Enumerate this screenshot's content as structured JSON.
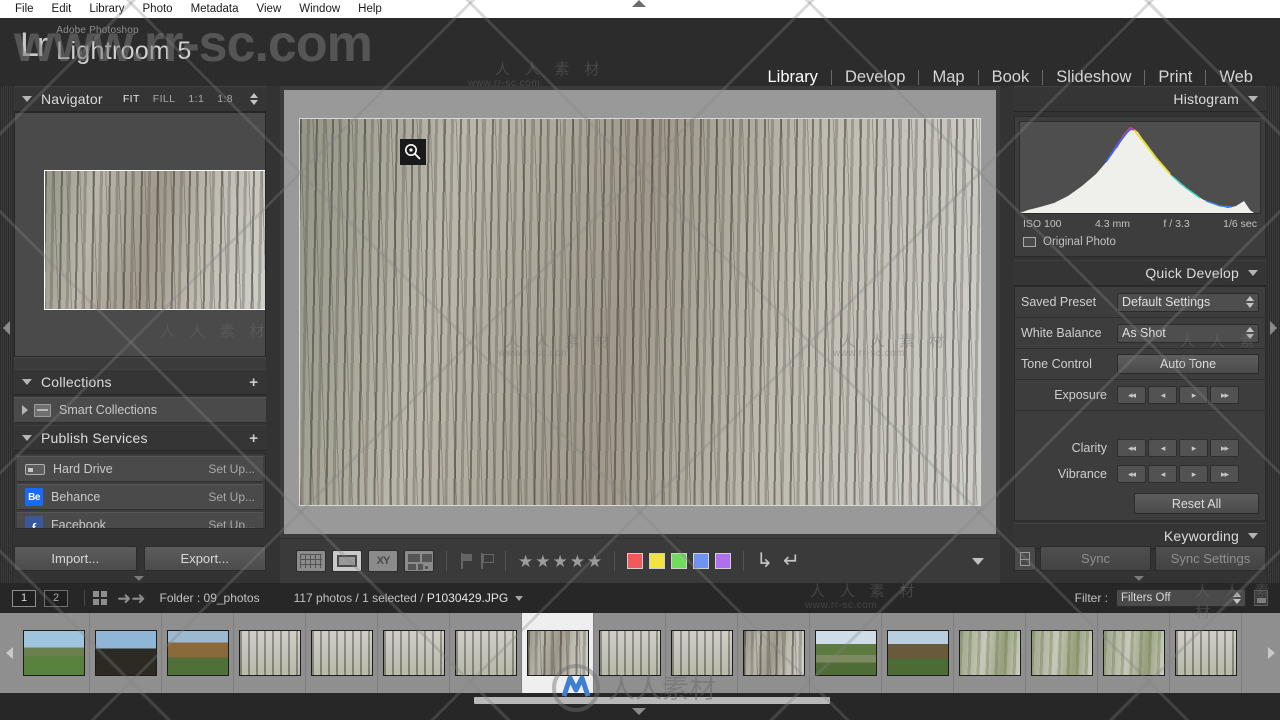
{
  "menubar": {
    "items": [
      "File",
      "Edit",
      "Library",
      "Photo",
      "Metadata",
      "View",
      "Window",
      "Help"
    ]
  },
  "header": {
    "logo_mark": "Lr",
    "product_prefix": "Adobe Photoshop",
    "product_name": "Lightroom 5",
    "modules": [
      {
        "label": "Library",
        "active": true
      },
      {
        "label": "Develop",
        "active": false
      },
      {
        "label": "Map",
        "active": false
      },
      {
        "label": "Book",
        "active": false
      },
      {
        "label": "Slideshow",
        "active": false
      },
      {
        "label": "Print",
        "active": false
      },
      {
        "label": "Web",
        "active": false
      }
    ]
  },
  "left_panel": {
    "navigator": {
      "title": "Navigator",
      "zoom_levels": [
        {
          "label": "FIT",
          "selected": true
        },
        {
          "label": "FILL",
          "selected": false
        },
        {
          "label": "1:1",
          "selected": false
        },
        {
          "label": "1:8",
          "selected": false
        }
      ]
    },
    "collections": {
      "title": "Collections",
      "add_label": "+",
      "items": [
        {
          "label": "Smart Collections",
          "icon": "collection-box-icon"
        }
      ]
    },
    "publish_services": {
      "title": "Publish Services",
      "add_label": "+",
      "items": [
        {
          "label": "Hard Drive",
          "action": "Set Up...",
          "icon": "hard-drive-icon"
        },
        {
          "label": "Behance",
          "action": "Set Up...",
          "icon": "behance-icon",
          "glyph": "Be"
        },
        {
          "label": "Facebook",
          "action": "Set Up...",
          "icon": "facebook-icon",
          "glyph": "f"
        }
      ]
    },
    "buttons": {
      "import": "Import...",
      "export": "Export..."
    }
  },
  "right_panel": {
    "histogram": {
      "title": "Histogram",
      "iso": "ISO 100",
      "focal_length": "4.3 mm",
      "aperture": "f / 3.3",
      "shutter": "1/6 sec",
      "original_photo": "Original Photo"
    },
    "quick_develop": {
      "title": "Quick Develop",
      "saved_preset_label": "Saved Preset",
      "saved_preset_value": "Default Settings",
      "white_balance_label": "White Balance",
      "white_balance_value": "As Shot",
      "tone_control_label": "Tone Control",
      "auto_tone_label": "Auto Tone",
      "sliders": [
        {
          "label": "Exposure"
        },
        {
          "label": "Clarity"
        },
        {
          "label": "Vibrance"
        }
      ],
      "arrow_glyphs": [
        "◂◂",
        "◂",
        "▸",
        "▸▸"
      ],
      "reset_label": "Reset All"
    },
    "keywording": {
      "title": "Keywording"
    },
    "sync": {
      "sync_label": "Sync",
      "sync_settings_label": "Sync Settings"
    }
  },
  "toolbar": {
    "view_modes": [
      {
        "name": "grid-view",
        "selected": false
      },
      {
        "name": "loupe-view",
        "selected": true
      },
      {
        "name": "compare-view",
        "selected": false,
        "glyph": "XY"
      },
      {
        "name": "survey-view",
        "selected": false
      }
    ],
    "stars": 5,
    "color_labels": [
      {
        "name": "red",
        "hex": "#f05a5a"
      },
      {
        "name": "yellow",
        "hex": "#f2e43c"
      },
      {
        "name": "green",
        "hex": "#6fdc5c"
      },
      {
        "name": "blue",
        "hex": "#6f93f2"
      },
      {
        "name": "purple",
        "hex": "#b06ef0"
      }
    ],
    "rotate_left_glyph": "↳",
    "rotate_right_glyph": "↵"
  },
  "filmstrip_bar": {
    "page_buttons": [
      "1",
      "2"
    ],
    "folder_label": "Folder : 09_photos",
    "photo_count": "117 photos /",
    "selected_count": "1 selected /",
    "filename": "P1030429.JPG",
    "filter_label": "Filter :",
    "filter_value": "Filters Off"
  },
  "filmstrip": {
    "thumbnails": [
      {
        "texture": "tex-field",
        "selected": false
      },
      {
        "texture": "tex-dark",
        "selected": false
      },
      {
        "texture": "tex-autumn",
        "selected": false
      },
      {
        "texture": "tex-birch",
        "selected": false
      },
      {
        "texture": "tex-birch",
        "selected": false
      },
      {
        "texture": "tex-birch",
        "selected": false
      },
      {
        "texture": "tex-birch",
        "selected": false
      },
      {
        "texture": "tex-bark",
        "selected": true
      },
      {
        "texture": "tex-birch",
        "selected": false
      },
      {
        "texture": "tex-birch",
        "selected": false
      },
      {
        "texture": "tex-bark",
        "selected": false
      },
      {
        "texture": "tex-path",
        "selected": false
      },
      {
        "texture": "tex-trees",
        "selected": false
      },
      {
        "texture": "tex-moss",
        "selected": false
      },
      {
        "texture": "tex-moss",
        "selected": false
      },
      {
        "texture": "tex-moss",
        "selected": false
      },
      {
        "texture": "tex-birch",
        "selected": false
      }
    ]
  },
  "watermarks": {
    "main": "www.rr-sc.com",
    "cn_text": "人 人 素 材",
    "url_small": "www.rr-sc.com"
  }
}
